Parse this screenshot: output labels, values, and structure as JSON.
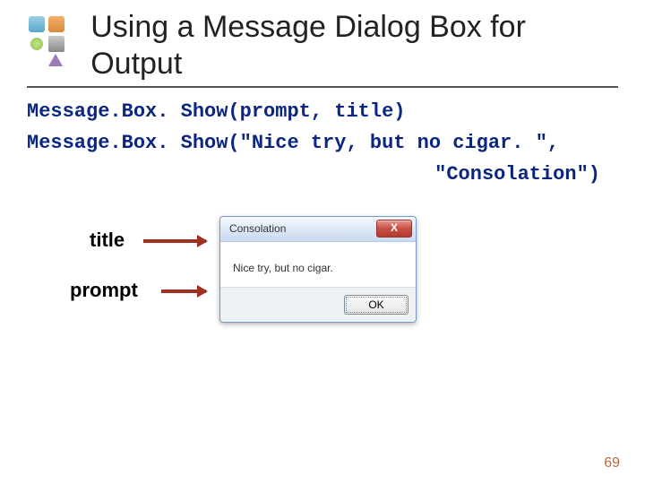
{
  "header": {
    "title": "Using a Message Dialog Box for Output"
  },
  "code": {
    "line1": "Message.Box. Show(prompt, title)",
    "line2": "Message.Box. Show(\"Nice try, but no cigar. \",",
    "line3": "\"Consolation\")"
  },
  "labels": {
    "title": "title",
    "prompt": "prompt"
  },
  "dialog": {
    "title": "Consolation",
    "prompt": "Nice try, but no cigar.",
    "ok": "OK",
    "close": "X"
  },
  "page_number": "69"
}
